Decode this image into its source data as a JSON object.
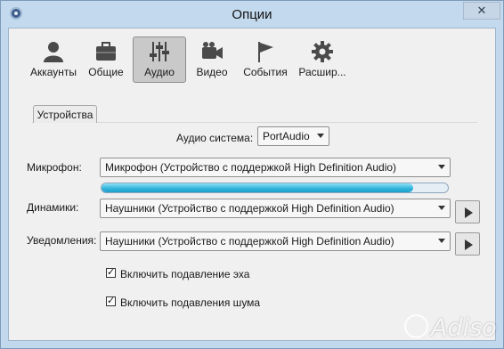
{
  "window": {
    "title": "Опции",
    "close_glyph": "✕"
  },
  "toolbar": {
    "items": [
      {
        "label": "Аккаунты",
        "icon": "user-icon",
        "active": false
      },
      {
        "label": "Общие",
        "icon": "briefcase-icon",
        "active": false
      },
      {
        "label": "Аудио",
        "icon": "sliders-icon",
        "active": true
      },
      {
        "label": "Видео",
        "icon": "video-camera-icon",
        "active": false
      },
      {
        "label": "События",
        "icon": "flag-icon",
        "active": false
      },
      {
        "label": "Расшир...",
        "icon": "gear-icon",
        "active": false
      }
    ]
  },
  "tab": {
    "label": "Устройства"
  },
  "audio_system": {
    "label": "Аудио система:",
    "value": "PortAudio"
  },
  "microphone": {
    "label": "Микрофон:",
    "value": "Микрофон (Устройство с поддержкой High Definition Audio)",
    "level": 0.9
  },
  "speakers": {
    "label": "Динамики:",
    "value": "Наушники (Устройство с поддержкой High Definition Audio)"
  },
  "notifications": {
    "label": "Уведомления:",
    "value": "Наушники (Устройство с поддержкой High Definition Audio)"
  },
  "options": {
    "echo": {
      "label": "Включить подавление эха",
      "checked": true
    },
    "noise": {
      "label": "Включить подавления шума",
      "checked": true
    }
  },
  "watermark": {
    "text": "Adiso"
  },
  "colors": {
    "accent": "#35b6dc",
    "titlebar": "#c3d9ee"
  }
}
